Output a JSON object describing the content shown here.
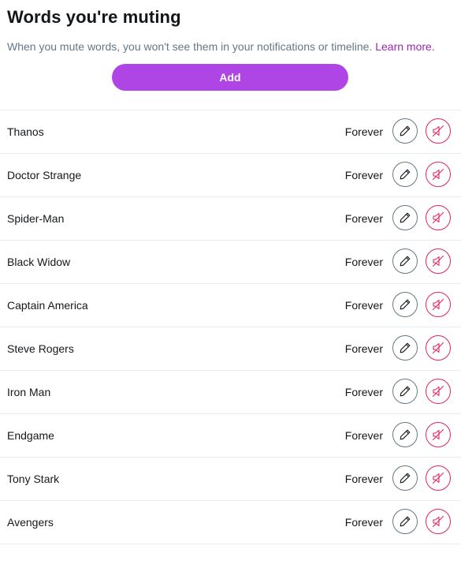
{
  "header": {
    "title": "Words you're muting",
    "description": "When you mute words, you won't see them in your notifications or timeline.",
    "learn_more": "Learn more."
  },
  "add_button": {
    "label": "Add",
    "color": "#b045e6"
  },
  "colors": {
    "edit_icon": "#657786",
    "unmute_icon": "#e0245e",
    "link": "#9c27b0"
  },
  "icons": {
    "edit": "pencil-icon",
    "unmute": "muted-speaker-icon"
  },
  "muted_words": [
    {
      "word": "Thanos",
      "duration": "Forever"
    },
    {
      "word": "Doctor Strange",
      "duration": "Forever"
    },
    {
      "word": "Spider-Man",
      "duration": "Forever"
    },
    {
      "word": "Black Widow",
      "duration": "Forever"
    },
    {
      "word": "Captain America",
      "duration": "Forever"
    },
    {
      "word": "Steve Rogers",
      "duration": "Forever"
    },
    {
      "word": "Iron Man",
      "duration": "Forever"
    },
    {
      "word": "Endgame",
      "duration": "Forever"
    },
    {
      "word": "Tony Stark",
      "duration": "Forever"
    },
    {
      "word": "Avengers",
      "duration": "Forever"
    }
  ]
}
